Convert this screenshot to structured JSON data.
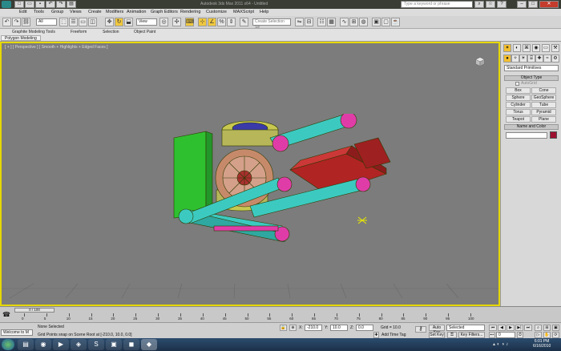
{
  "window": {
    "title": "Autodesk 3ds Max 2011 x64 - Untitled",
    "search_placeholder": "Type a keyword or phrase"
  },
  "menu": [
    "Edit",
    "Tools",
    "Group",
    "Views",
    "Create",
    "Modifiers",
    "Animation",
    "Graph Editors",
    "Rendering",
    "Customize",
    "MAXScript",
    "Help"
  ],
  "toolbar": {
    "selection_filter": "All",
    "ref_coord": "View",
    "named_selection": "Create Selection Se"
  },
  "ribbon": {
    "tabs": [
      "Graphite Modeling Tools",
      "Freeform",
      "Selection",
      "Object Paint"
    ],
    "sub_tab": "Polygon Modeling"
  },
  "viewport": {
    "label": "[ + ] [ Perspective ] [ Smooth + Highlights + Edged Faces ]"
  },
  "command_panel": {
    "category": "Standard Primitives",
    "object_type_header": "Object Type",
    "autogrid": "AutoGrid",
    "buttons": [
      "Box",
      "Cone",
      "Sphere",
      "GeoSphere",
      "Cylinder",
      "Tube",
      "Torus",
      "Pyramid",
      "Teapot",
      "Plane"
    ],
    "name_color_header": "Name and Color",
    "object_color": "#9e1030"
  },
  "timeline": {
    "frame_display": "0 / 100",
    "ticks": [
      "0",
      "5",
      "10",
      "15",
      "20",
      "25",
      "30",
      "35",
      "40",
      "45",
      "50",
      "55",
      "60",
      "65",
      "70",
      "75",
      "80",
      "85",
      "90",
      "95",
      "100"
    ]
  },
  "status": {
    "listener": "Welcome to M",
    "selection": "None Selected",
    "prompt": "Grid Points snap on Scene Root at [-210.0, 10.0, 0.0]",
    "x": "-210.0",
    "y": "10.0",
    "z": "0.0",
    "grid": "Grid = 10.0",
    "add_time_tag": "Add Time Tag",
    "auto_key": "Auto Key",
    "set_key": "Set Key",
    "selected": "Selected",
    "key_filters": "Key Filters...",
    "frame": "0",
    "x_label": "X:",
    "y_label": "Y:",
    "z_label": "Z:"
  },
  "taskbar": {
    "time": "6:01 PM",
    "date": "6/16/2010"
  }
}
